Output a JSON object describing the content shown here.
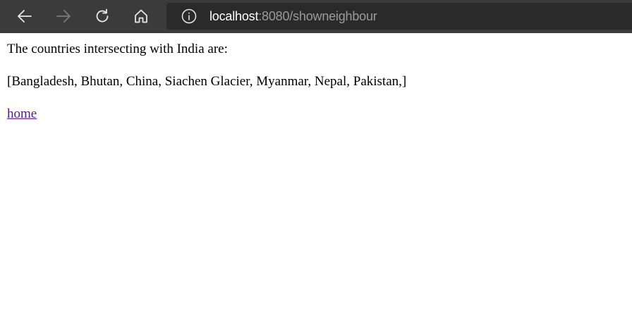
{
  "browser": {
    "back_icon": "arrow-left-icon",
    "forward_icon": "arrow-right-icon",
    "reload_icon": "refresh-icon",
    "home_icon": "home-icon",
    "site_info_icon": "info-icon",
    "url_host": "localhost",
    "url_rest": ":8080/showneighbour"
  },
  "page": {
    "heading_text": "The countries intersecting with India are:",
    "neighbours_text": "[Bangladesh, Bhutan, China, Siachen Glacier, Myanmar, Nepal, Pakistan,]",
    "home_link_label": "home"
  },
  "colors": {
    "toolbar_bg": "#3b3b3b",
    "addressbar_bg": "#2a2a2a",
    "link_visited": "#551a8b"
  }
}
